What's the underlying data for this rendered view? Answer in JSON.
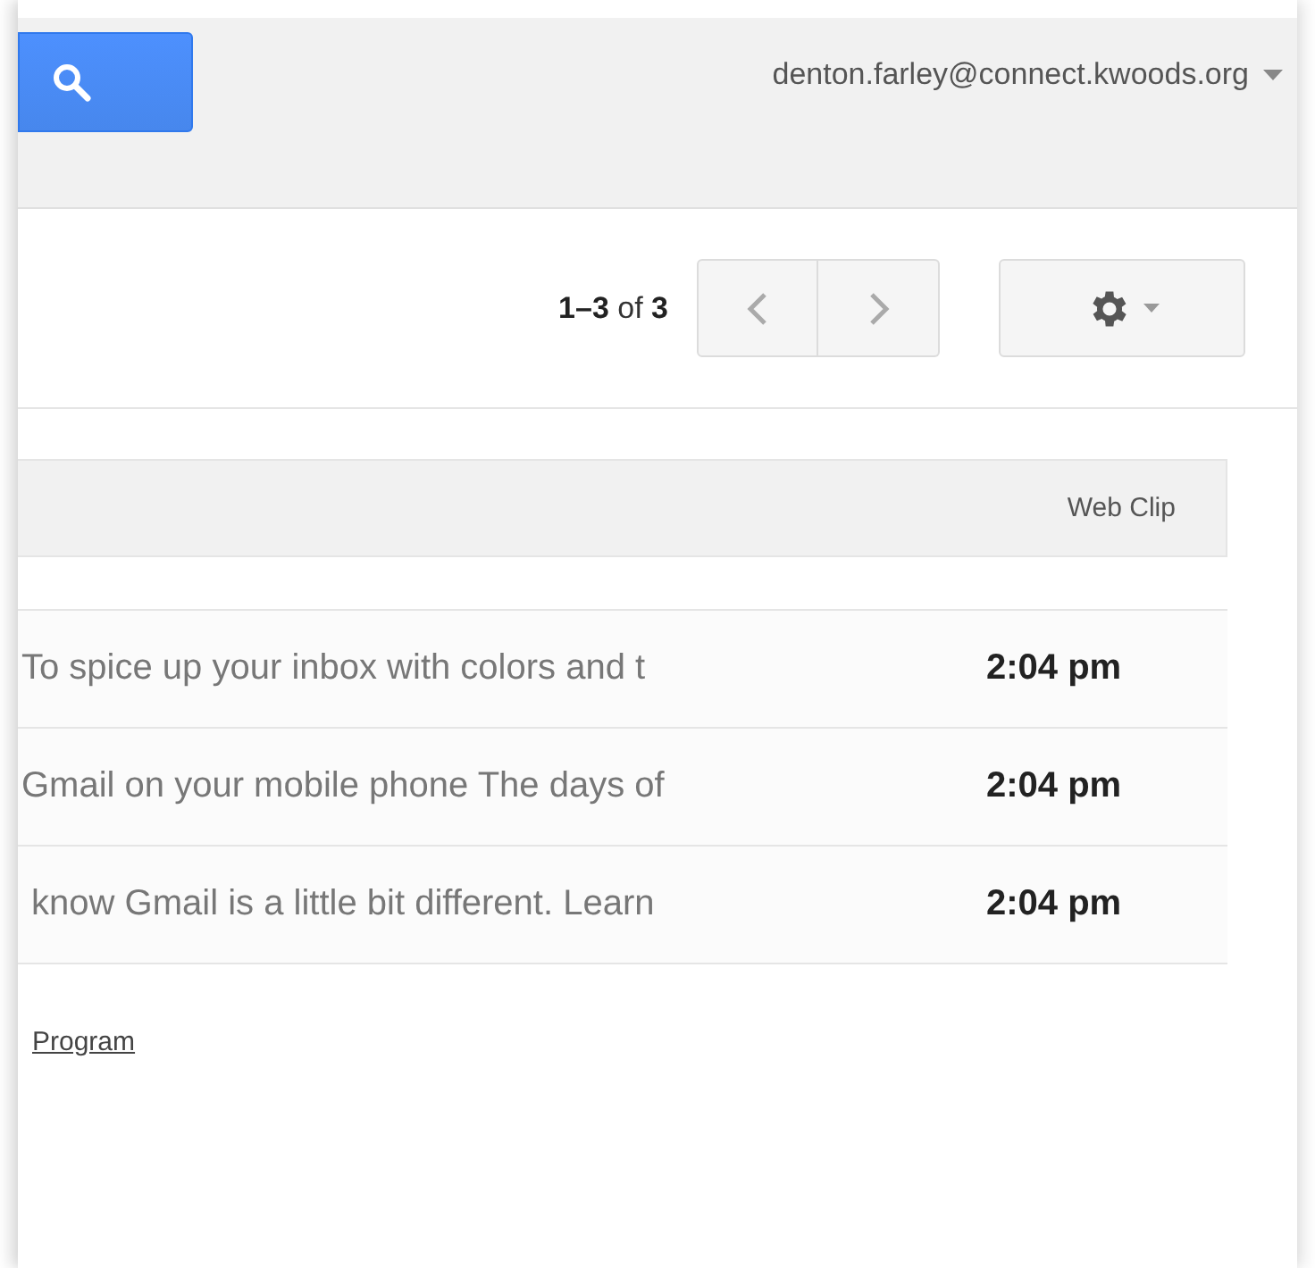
{
  "header": {
    "account": "denton.farley@connect.kwoods.org"
  },
  "toolbar": {
    "range": "**1–3** of **3**"
  },
  "web_clip": {
    "label": "Web Clip"
  },
  "messages": [
    {
      "snippet": "To spice up your inbox with colors and t",
      "time": "2:04 pm",
      "unread": true
    },
    {
      "snippet": "Gmail on your mobile phone The days of",
      "time": "2:04 pm",
      "unread": true
    },
    {
      "snippet": " know Gmail is a little bit different. Learn",
      "time": "2:04 pm",
      "unread": true
    }
  ],
  "footer": {
    "link": "Program"
  }
}
